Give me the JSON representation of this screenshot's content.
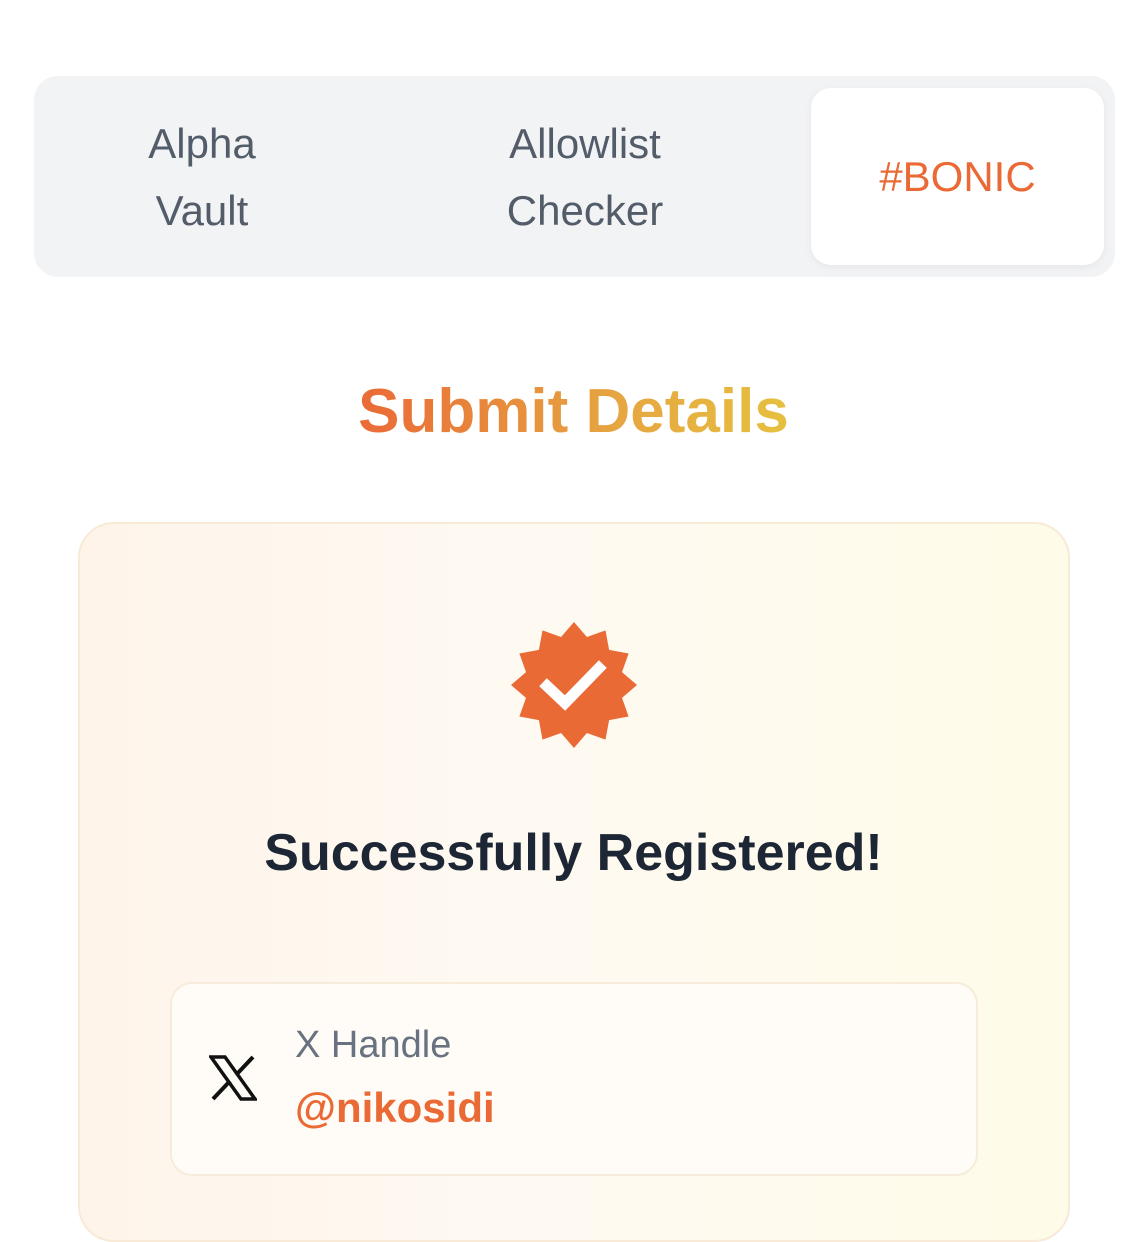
{
  "tabs": [
    {
      "label": "Alpha\nVault",
      "active": false
    },
    {
      "label": "Allowlist\nChecker",
      "active": false
    },
    {
      "label": "#BONIC",
      "active": true
    }
  ],
  "page": {
    "title": "Submit Details"
  },
  "status": {
    "message": "Successfully Registered!",
    "icon": "verified-badge-icon"
  },
  "handle": {
    "icon": "x-logo-icon",
    "label": "X Handle",
    "value": "@nikosidi"
  },
  "colors": {
    "accent": "#ea6a36",
    "gradient_end": "#e6c040",
    "tab_bg": "#f2f3f5",
    "text_dark": "#1d2634"
  }
}
